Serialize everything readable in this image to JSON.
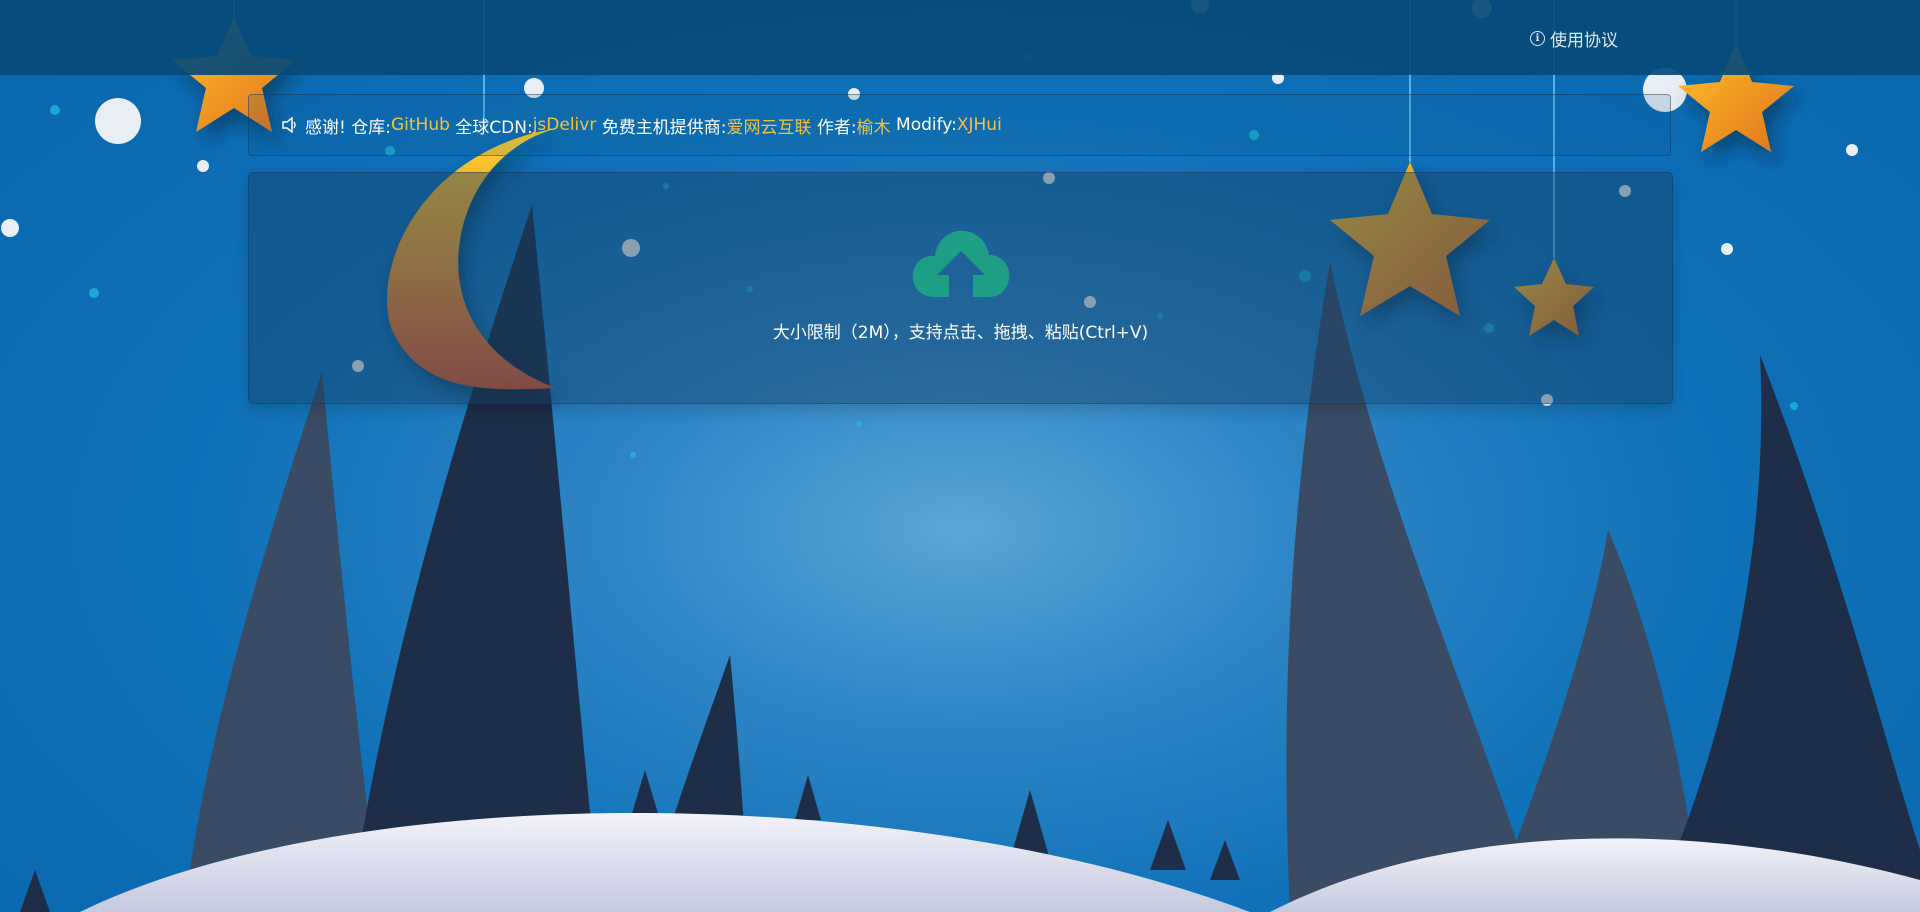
{
  "header": {
    "terms_link": "使用协议",
    "terms_icon": "info-circle-icon"
  },
  "notice": {
    "icon": "speaker-icon",
    "thanks": "感谢!",
    "repo_label": "仓库:",
    "repo_link": "GitHub",
    "cdn_label": "全球CDN:",
    "cdn_link": "jsDelivr",
    "host_label": "免费主机提供商:",
    "host_link": "爱网云互联",
    "author_label": "作者:",
    "author_link": "榆木",
    "modify_label": "Modify:",
    "modify_link": "XJHui"
  },
  "upload": {
    "icon": "cloud-upload-icon",
    "hint": "大小限制（2M），支持点击、拖拽、粘贴(Ctrl+V)"
  },
  "colors": {
    "link": "#f5c23a",
    "upload_icon": "#1f9e86",
    "topbar": "#064a78",
    "sky": "#0f71b8"
  }
}
